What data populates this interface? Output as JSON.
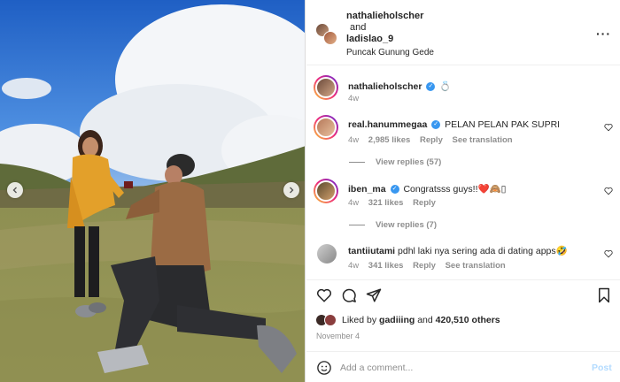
{
  "post": {
    "author": "nathalieholscher",
    "and_text": "and",
    "coauthor": "ladislao_9",
    "location": "Puncak Gunung Gede",
    "more_icon": "more-horizontal-icon"
  },
  "caption": {
    "username": "nathalieholscher",
    "emoji": "💍",
    "time": "4w"
  },
  "comments": [
    {
      "username": "real.hanummegaa",
      "verified": true,
      "text": "PELAN PELAN PAK SUPRI",
      "time": "4w",
      "likes": "2,985 likes",
      "reply": "Reply",
      "translate": "See translation",
      "view_replies": "View replies (57)"
    },
    {
      "username": "iben_ma",
      "verified": true,
      "text": "Congratsss guys!!❤️🙈▯",
      "time": "4w",
      "likes": "321 likes",
      "reply": "Reply",
      "view_replies": "View replies (7)"
    },
    {
      "username": "tantiiutami",
      "verified": false,
      "text": "pdhl laki nya sering ada di dating apps🤣",
      "time": "4w",
      "likes": "341 likes",
      "reply": "Reply",
      "translate": "See translation"
    }
  ],
  "likes": {
    "prefix": "Liked by",
    "user": "gadiiing",
    "middle": "and",
    "count": "420,510 others"
  },
  "date": "November 4",
  "composer": {
    "placeholder": "Add a comment...",
    "post_label": "Post"
  },
  "colors": {
    "verified": "#3897f0",
    "post_disabled": "#b3dbff",
    "muted": "#8e8e8e"
  }
}
